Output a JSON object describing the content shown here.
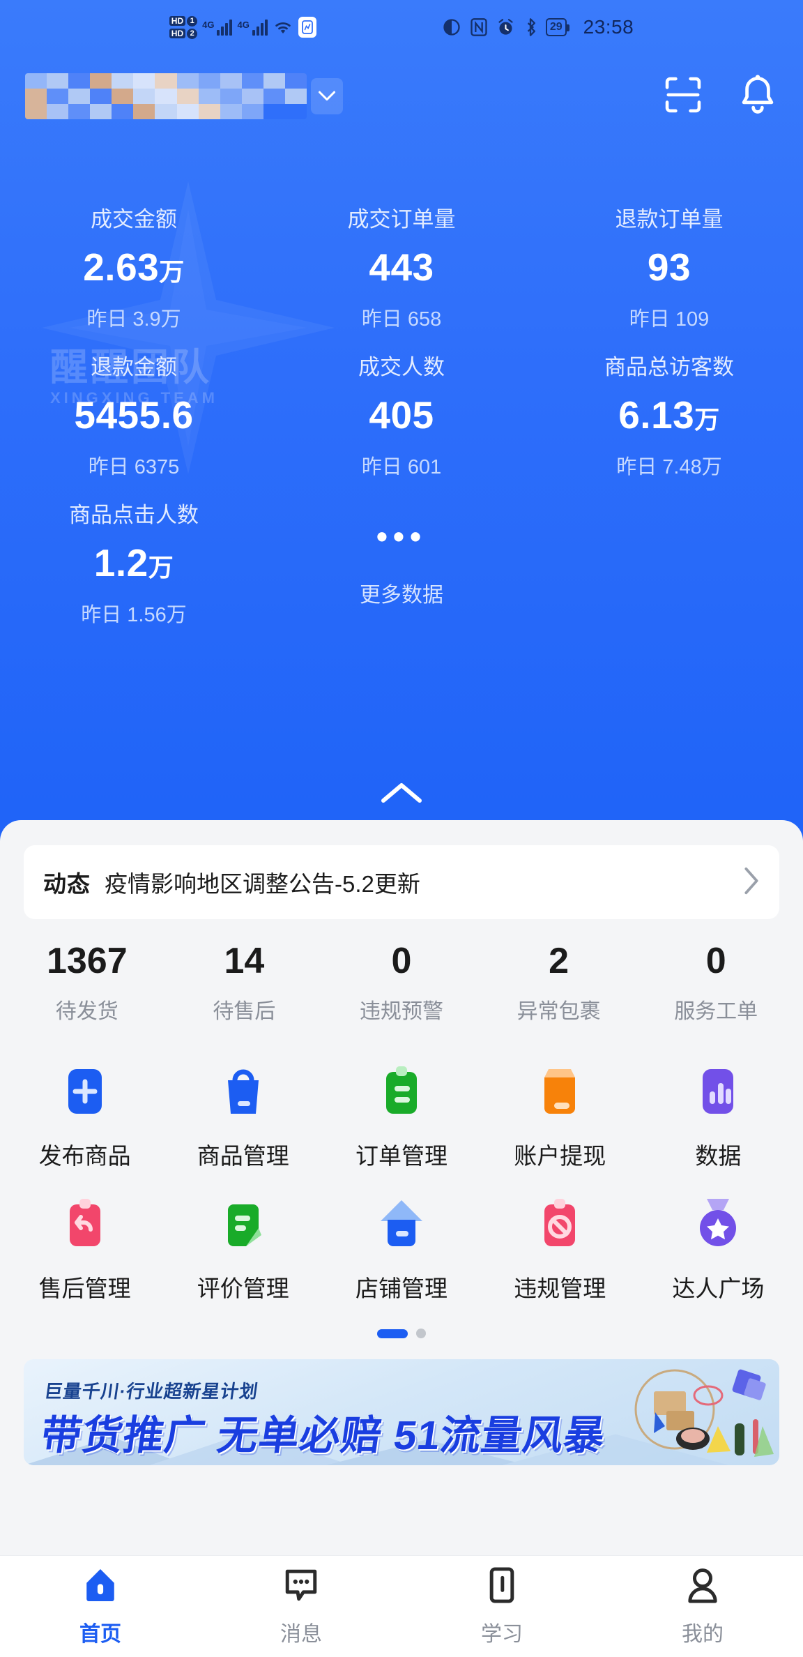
{
  "status_bar": {
    "hd1": "HD",
    "hd1_num": "1",
    "hd2": "HD",
    "hd2_num": "2",
    "network_1": "4G",
    "network_2": "4G",
    "wifi_icon": "wifi-icon",
    "app_icon": "app-indicator-icon",
    "eye_icon": "eye-comfort-icon",
    "nfc_icon": "nfc-icon",
    "alarm_icon": "alarm-icon",
    "bluetooth_icon": "bluetooth-icon",
    "battery_level": "29",
    "time": "23:58"
  },
  "header": {
    "shop_name_masked": "",
    "chevron_icon": "chevron-down-icon",
    "scan_icon": "scan-icon",
    "bell_icon": "bell-icon"
  },
  "watermark": {
    "main": "醒醒团队",
    "sub": "XINGXING TEAM"
  },
  "stats": {
    "yesterday_prefix": "昨日",
    "items": [
      {
        "label": "成交金额",
        "value": "2.63",
        "unit": "万",
        "sub": "昨日 3.9万"
      },
      {
        "label": "成交订单量",
        "value": "443",
        "unit": "",
        "sub": "昨日 658"
      },
      {
        "label": "退款订单量",
        "value": "93",
        "unit": "",
        "sub": "昨日 109"
      },
      {
        "label": "退款金额",
        "value": "5455.6",
        "unit": "",
        "sub": "昨日 6375"
      },
      {
        "label": "成交人数",
        "value": "405",
        "unit": "",
        "sub": "昨日 601"
      },
      {
        "label": "商品总访客数",
        "value": "6.13",
        "unit": "万",
        "sub": "昨日 7.48万"
      },
      {
        "label": "商品点击人数",
        "value": "1.2",
        "unit": "万",
        "sub": "昨日 1.56万"
      }
    ],
    "more_dots": "•••",
    "more_label": "更多数据",
    "collapse_icon": "chevron-up-icon"
  },
  "notice": {
    "badge": "动态",
    "text": "疫情影响地区调整公告-5.2更新",
    "arrow_icon": "chevron-right-icon"
  },
  "counters": [
    {
      "num": "1367",
      "label": "待发货"
    },
    {
      "num": "14",
      "label": "待售后"
    },
    {
      "num": "0",
      "label": "违规预警"
    },
    {
      "num": "2",
      "label": "异常包裹"
    },
    {
      "num": "0",
      "label": "服务工单"
    }
  ],
  "quick_actions": [
    {
      "label": "发布商品",
      "icon": "publish-product-icon",
      "color": "#1c5df2"
    },
    {
      "label": "商品管理",
      "icon": "product-bag-icon",
      "color": "#1c5df2"
    },
    {
      "label": "订单管理",
      "icon": "order-clipboard-icon",
      "color": "#19ab29"
    },
    {
      "label": "账户提现",
      "icon": "wallet-withdraw-icon",
      "color": "#f7820a"
    },
    {
      "label": "数据",
      "icon": "data-chart-icon",
      "color": "#7250e8"
    },
    {
      "label": "售后管理",
      "icon": "after-sale-return-icon",
      "color": "#f2466b"
    },
    {
      "label": "评价管理",
      "icon": "review-pencil-icon",
      "color": "#19ab29"
    },
    {
      "label": "店铺管理",
      "icon": "shop-house-icon",
      "color": "#1c5df2"
    },
    {
      "label": "违规管理",
      "icon": "violation-ban-icon",
      "color": "#f2466b"
    },
    {
      "label": "达人广场",
      "icon": "talent-medal-icon",
      "color": "#7250e8"
    }
  ],
  "pager": {
    "active_index": 0,
    "count": 2
  },
  "banner": {
    "top_text": "巨量千川·行业超新星计划",
    "main_text": "带货推广 无单必赔 51流量风暴"
  },
  "tabbar": [
    {
      "label": "首页",
      "icon": "home-icon",
      "active": true
    },
    {
      "label": "消息",
      "icon": "message-icon",
      "active": false
    },
    {
      "label": "学习",
      "icon": "study-icon",
      "active": false
    },
    {
      "label": "我的",
      "icon": "profile-icon",
      "active": false
    }
  ],
  "colors": {
    "hero_blue": "#2f6ffa",
    "accent": "#1c5df2",
    "sheet_bg": "#f4f5f7",
    "muted_text": "#8a8f99"
  }
}
